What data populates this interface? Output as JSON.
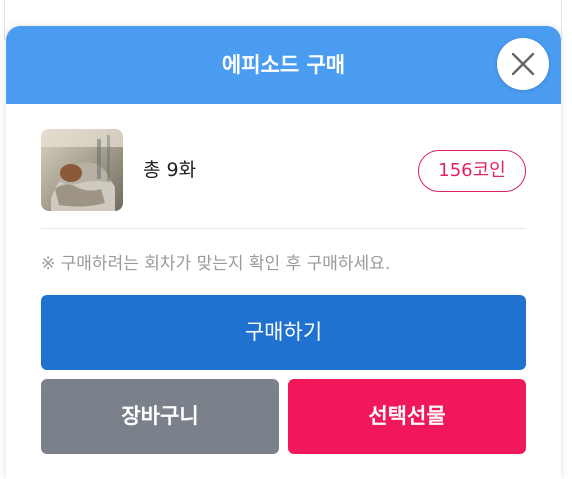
{
  "modal": {
    "title": "에피소드 구매",
    "close_icon": "close-icon"
  },
  "summary": {
    "thumbnail_icon": "cover-thumbnail",
    "episode_count": "총 9화",
    "price": "156코인"
  },
  "notice": "※ 구매하려는 회차가 맞는지 확인 후 구매하세요.",
  "buttons": {
    "buy": "구매하기",
    "cart": "장바구니",
    "gift": "선택선물"
  },
  "colors": {
    "header": "#4a9cf0",
    "buy": "#1f72d0",
    "cart": "#7b818a",
    "gift": "#f0175b",
    "price_accent": "#e0245e"
  }
}
